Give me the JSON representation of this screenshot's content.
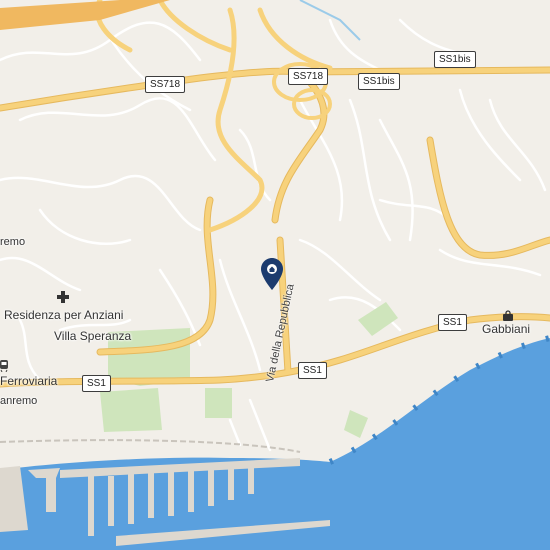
{
  "map": {
    "road_shields": [
      {
        "id": "ss718-west",
        "text": "SS718"
      },
      {
        "id": "ss718-east",
        "text": "SS718"
      },
      {
        "id": "ss1bis-mid",
        "text": "SS1bis"
      },
      {
        "id": "ss1bis-east",
        "text": "SS1bis"
      },
      {
        "id": "ss1-east",
        "text": "SS1"
      },
      {
        "id": "ss1-mid",
        "text": "SS1"
      },
      {
        "id": "ss1-west",
        "text": "SS1"
      }
    ],
    "place_labels": {
      "remo": "remo",
      "residenza": "Residenza per Anziani",
      "villa": "Villa Speranza",
      "ferroviaria": "Ferroviaria",
      "sanremo": "anremo",
      "gabbiani": "Gabbiani"
    },
    "street_label": "Via della Repubblica",
    "icons": {
      "pin": "map-marker-icon",
      "medical": "medical-cross-icon",
      "shop": "shopping-bag-icon",
      "rail": "railway-icon"
    },
    "colors": {
      "land": "#f2efe9",
      "water": "#5aa0de",
      "park": "#cfe5bc",
      "road_major": "#f7d27c",
      "road_minor": "#ffffff",
      "pin": "#1c3b6e"
    }
  }
}
